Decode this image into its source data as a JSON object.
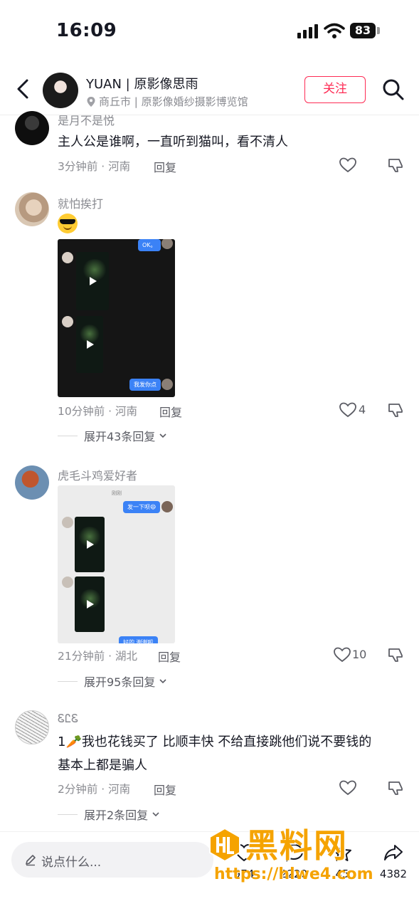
{
  "status_bar": {
    "time": "16:09",
    "battery": "83"
  },
  "header": {
    "name": "YUAN | 原影像思雨",
    "location": "商丘市 | 原影像婚纱摄影博览馆",
    "follow_label": "关注"
  },
  "comments": [
    {
      "user": "是月不是悦",
      "text": "主人公是谁啊，一直听到猫叫，看不清人",
      "time_location": "3分钟前 · 河南",
      "reply_label": "回复",
      "likes": ""
    },
    {
      "user": "就怕挨打",
      "emoji": "cool-face-emoji",
      "screenshot": {
        "bubble_top": "OK。",
        "bubble_bottom": "我发你点"
      },
      "time_location": "10分钟前 · 河南",
      "reply_label": "回复",
      "likes": "4",
      "expand_label": "展开43条回复"
    },
    {
      "user": "虎毛斗鸡爱好者",
      "screenshot": {
        "header_text": "刚刚",
        "bubble_top": "发一下呗😄",
        "bubble_bottom": "好的 谢谢啦"
      },
      "time_location": "21分钟前 · 湖北",
      "reply_label": "回复",
      "likes": "10",
      "expand_label": "展开95条回复"
    },
    {
      "user": "ᏋᏝᏋ",
      "text_line1": "1🥕我也花钱买了 比顺丰快 不给直接跳他们说不要钱的",
      "text_line2": "基本上都是骗人",
      "time_location": "2分钟前 · 河南",
      "reply_label": "回复",
      "likes": "",
      "expand_label": "展开2条回复"
    }
  ],
  "bottom_bar": {
    "placeholder": "说点什么...",
    "like_count": "974",
    "comment_count": "2220",
    "favorite_count": "45",
    "share_count": "4382"
  },
  "watermark": {
    "title": "黑料网",
    "url": "https://hlwe4.com"
  },
  "colors": {
    "accent": "#fe2c55",
    "muted": "#8a8b91",
    "watermark": "#f5a300"
  }
}
